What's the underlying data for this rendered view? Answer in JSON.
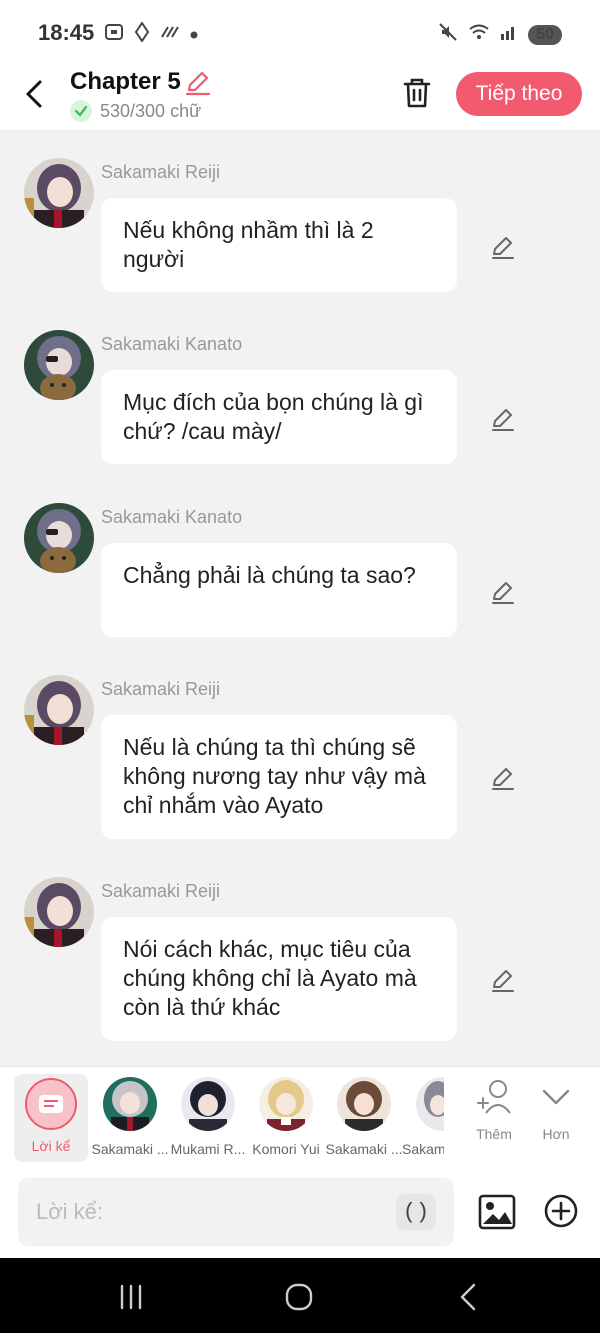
{
  "status_bar": {
    "time": "18:45",
    "battery": "50"
  },
  "header": {
    "title": "Chapter 5",
    "word_count": "530/300 chữ",
    "next_button": "Tiếp theo"
  },
  "messages": [
    {
      "sender": "Sakamaki Reiji",
      "text": "Nếu không nhầm thì là 2 người"
    },
    {
      "sender": "Sakamaki Kanato",
      "text": "Mục đích của bọn chúng là gì chứ? /cau mày/"
    },
    {
      "sender": "Sakamaki Kanato",
      "text": "Chẳng phải là chúng ta sao?"
    },
    {
      "sender": "Sakamaki Reiji",
      "text": "Nếu là chúng ta thì chúng sẽ không nương tay như vậy mà chỉ nhắm vào Ayato"
    },
    {
      "sender": "Sakamaki Reiji",
      "text": "Nói cách khác, mục tiêu của chúng không chỉ là Ayato mà còn là thứ khác"
    }
  ],
  "character_bar": {
    "narrator_label": "Lời kể",
    "characters": [
      {
        "name": "Sakamaki ..."
      },
      {
        "name": "Mukami R..."
      },
      {
        "name": "Komori Yui"
      },
      {
        "name": "Sakamaki ..."
      },
      {
        "name": "Sakam"
      }
    ],
    "add_label": "Thêm",
    "more_label": "Hơn"
  },
  "input": {
    "placeholder": "Lời kể:",
    "paren_label": "()"
  },
  "colors": {
    "accent": "#f25a6f",
    "background": "#f2f2f2"
  }
}
